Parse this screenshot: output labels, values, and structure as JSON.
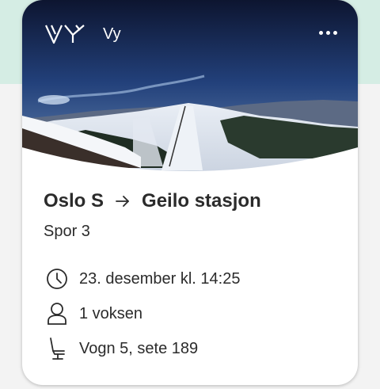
{
  "header": {
    "brand_logo": "VY",
    "brand_name": "Vy",
    "menu_icon": "more-dots-icon"
  },
  "trip": {
    "from": "Oslo S",
    "to": "Geilo stasjon",
    "track": "Spor 3",
    "departure": "23. desember kl. 14:25",
    "travellers": "1 voksen",
    "seat": "Vogn 5, sete 189"
  },
  "icons": {
    "route": "arrow-right-icon",
    "departure": "clock-icon",
    "travellers": "person-icon",
    "seat": "seat-icon"
  },
  "colors": {
    "page_top": "#d5ede4",
    "page_bottom": "#f3f3f3",
    "text": "#2b2b2b",
    "card": "#ffffff"
  }
}
